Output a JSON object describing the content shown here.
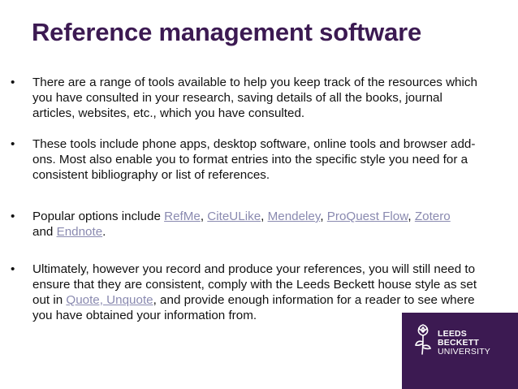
{
  "slide": {
    "title": "Reference management software",
    "bullet_symbol": "•",
    "bullets": [
      {
        "text": "There are a range of tools available to help you keep track of the resources which you have consulted in your research, saving details of all the books, journal articles, websites, etc., which you have consulted."
      },
      {
        "text": "These tools include phone apps, desktop software, online tools and browser add-ons. Most also enable you to format entries into the specific style you need for a consistent bibliography or list of references."
      },
      {
        "prefix": "Popular options include ",
        "links": [
          "RefMe",
          "CiteULike",
          "Mendeley",
          "ProQuest Flow",
          "Zotero",
          "Endnote"
        ],
        "separator": ", ",
        "and": "and ",
        "suffix": "."
      },
      {
        "before": "Ultimately, however you record and produce your references, you will still need to ensure that they are consistent, comply with the Leeds Beckett house style as set out in ",
        "link": "Quote, Unquote",
        "after": ", and provide enough information for a reader to see where you have obtained your information from."
      }
    ]
  },
  "brand": {
    "line1": "LEEDS",
    "line2": "BECKETT",
    "line3": "UNIVERSITY",
    "logo_icon": "rose-emblem-icon"
  },
  "colors": {
    "title": "#3c1a52",
    "link": "#8a8ab0",
    "brand_background": "#3c1a52"
  }
}
